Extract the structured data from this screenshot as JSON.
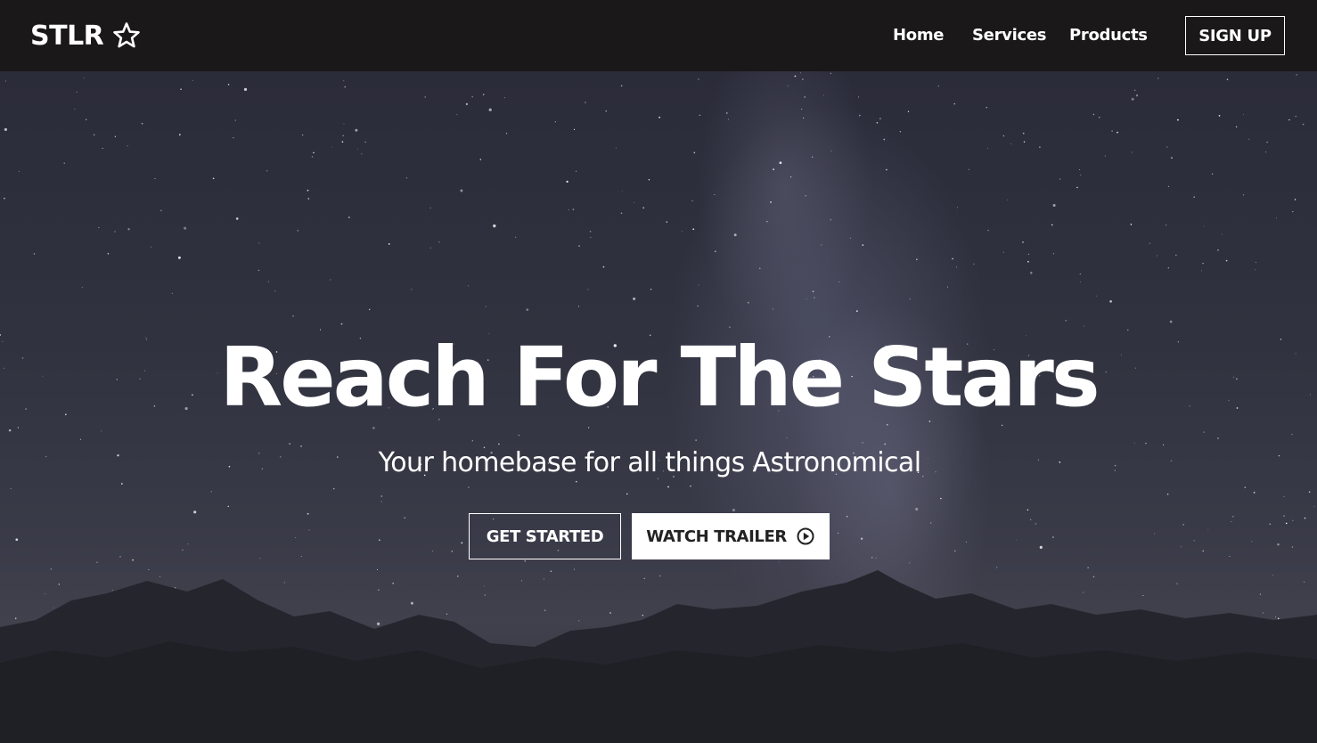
{
  "nav": {
    "brand": "STLR",
    "brand_icon": "star-outline-icon",
    "links": [
      {
        "label": "Home"
      },
      {
        "label": "Services"
      },
      {
        "label": "Products"
      }
    ],
    "signup_label": "SIGN UP"
  },
  "hero": {
    "title": "Reach For The Stars",
    "subtitle": "Your homebase for all things Astronomical",
    "primary_button": "GET STARTED",
    "secondary_button": "WATCH TRAILER",
    "secondary_button_icon": "play-circle-icon"
  },
  "colors": {
    "navbar_bg": "#1a1818",
    "text": "#ffffff",
    "button_solid_bg": "#ffffff",
    "button_solid_text": "#222222"
  }
}
